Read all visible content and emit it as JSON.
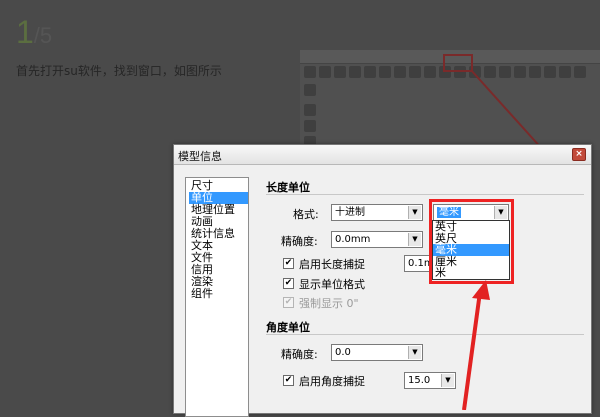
{
  "background": {
    "step_current": "1",
    "step_total": "/5",
    "caption": "首先打开su软件，找到窗口，如图所示"
  },
  "dialog": {
    "title": "模型信息",
    "close_glyph": "×",
    "nav_items": [
      "尺寸",
      "单位",
      "地理位置",
      "动画",
      "统计信息",
      "文本",
      "文件",
      "信用",
      "渲染",
      "组件"
    ],
    "nav_selected": 1,
    "length_section": "长度单位",
    "format_label": "格式:",
    "format_value": "十进制",
    "unit_value": "毫米",
    "unit_options": [
      "英寸",
      "英尺",
      "毫米",
      "厘米",
      "米"
    ],
    "unit_selected": 2,
    "precision_label": "精确度:",
    "precision_value": "0.0mm",
    "enable_length_snap": "启用长度捕捉",
    "length_snap_value": "0.1m",
    "show_unit_format": "显示单位格式",
    "force_display": "强制显示 0\"",
    "angle_section": "角度单位",
    "angle_precision_label": "精确度:",
    "angle_precision_value": "0.0",
    "enable_angle_snap": "启用角度捕捉",
    "angle_snap_value": "15.0"
  },
  "colors": {
    "highlight": "#3399ff",
    "annotation_red": "#e22222"
  }
}
